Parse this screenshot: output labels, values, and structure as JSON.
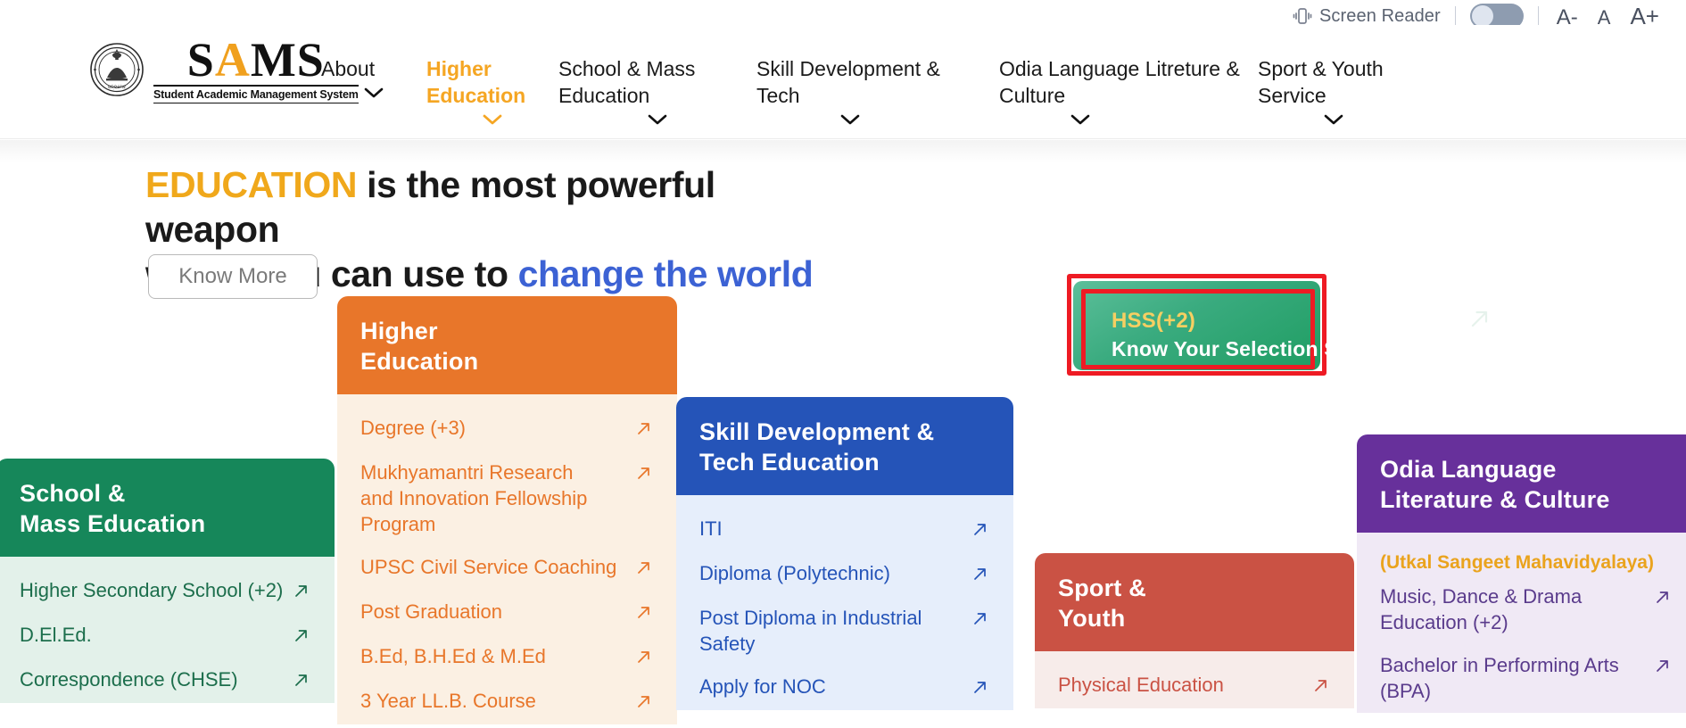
{
  "utility": {
    "screen_reader_label": "Screen Reader",
    "screen_reader_icon": "screen-reader-icon",
    "toggle_state": "off",
    "font_decrease": "A-",
    "font_normal": "A",
    "font_increase": "A+"
  },
  "brand": {
    "emblem_icon": "odisha-government-emblem-icon",
    "wordmark": "SAMS",
    "wordmark_accent_letter": "A",
    "tagline": "Student Academic Management System"
  },
  "nav": {
    "items": [
      {
        "label": "About",
        "active": false,
        "has_chevron": true
      },
      {
        "label": "Higher Education",
        "active": true,
        "has_chevron": true
      },
      {
        "label": "School & Mass Education",
        "active": false,
        "has_chevron": true
      },
      {
        "label": "Skill Development & Tech",
        "active": false,
        "has_chevron": true
      },
      {
        "label": "Odia Language Litreture & Culture",
        "active": false,
        "has_chevron": true
      },
      {
        "label": "Sport & Youth Service",
        "active": false,
        "has_chevron": true
      }
    ]
  },
  "hero": {
    "line1_highlight": "EDUCATION",
    "line1_rest": " is the most powerful weapon",
    "line2_start": "which you can use to ",
    "line2_link": "change the world",
    "know_more_label": "Know More"
  },
  "hss_promo": {
    "title": "HSS(+2)",
    "subtitle": "Know Your Selection Status",
    "arrow_icon": "arrow-up-right-icon",
    "highlight_color": "#ee1b24",
    "card_color": "#2ba874",
    "title_color": "#f6cf62"
  },
  "cards": [
    {
      "key": "school",
      "title_line1": "School &",
      "title_line2": "Mass Education",
      "header_color": "#16875a",
      "links": [
        {
          "label": "Higher Secondary School (+2)"
        },
        {
          "label": "D.El.Ed."
        },
        {
          "label": "Correspondence (CHSE)"
        }
      ]
    },
    {
      "key": "higher",
      "title_line1": "Higher",
      "title_line2": "Education",
      "header_color": "#e8762a",
      "links": [
        {
          "label": "Degree (+3)"
        },
        {
          "label": "Mukhyamantri Research and Innovation Fellowship Program"
        },
        {
          "label": "UPSC Civil Service Coaching"
        },
        {
          "label": "Post Graduation"
        },
        {
          "label": "B.Ed, B.H.Ed & M.Ed"
        },
        {
          "label": "3 Year LL.B. Course"
        }
      ]
    },
    {
      "key": "skill",
      "title_line1": "Skill Development &",
      "title_line2": "Tech Education",
      "header_color": "#2554b8",
      "links": [
        {
          "label": "ITI"
        },
        {
          "label": "Diploma (Polytechnic)"
        },
        {
          "label": "Post Diploma in Industrial Safety"
        },
        {
          "label": "Apply for NOC"
        }
      ]
    },
    {
      "key": "sport",
      "title_line1": "Sport &",
      "title_line2": "Youth",
      "header_color": "#ca5244",
      "links": [
        {
          "label": "Physical Education"
        }
      ]
    },
    {
      "key": "odia",
      "title_line1": "Odia Language",
      "title_line2": "Literature & Culture",
      "header_color": "#67309b",
      "note": "(Utkal Sangeet Mahavidyalaya)",
      "links": [
        {
          "label": "Music, Dance & Drama Education (+2)"
        },
        {
          "label": "Bachelor in Performing Arts (BPA)"
        }
      ]
    }
  ]
}
